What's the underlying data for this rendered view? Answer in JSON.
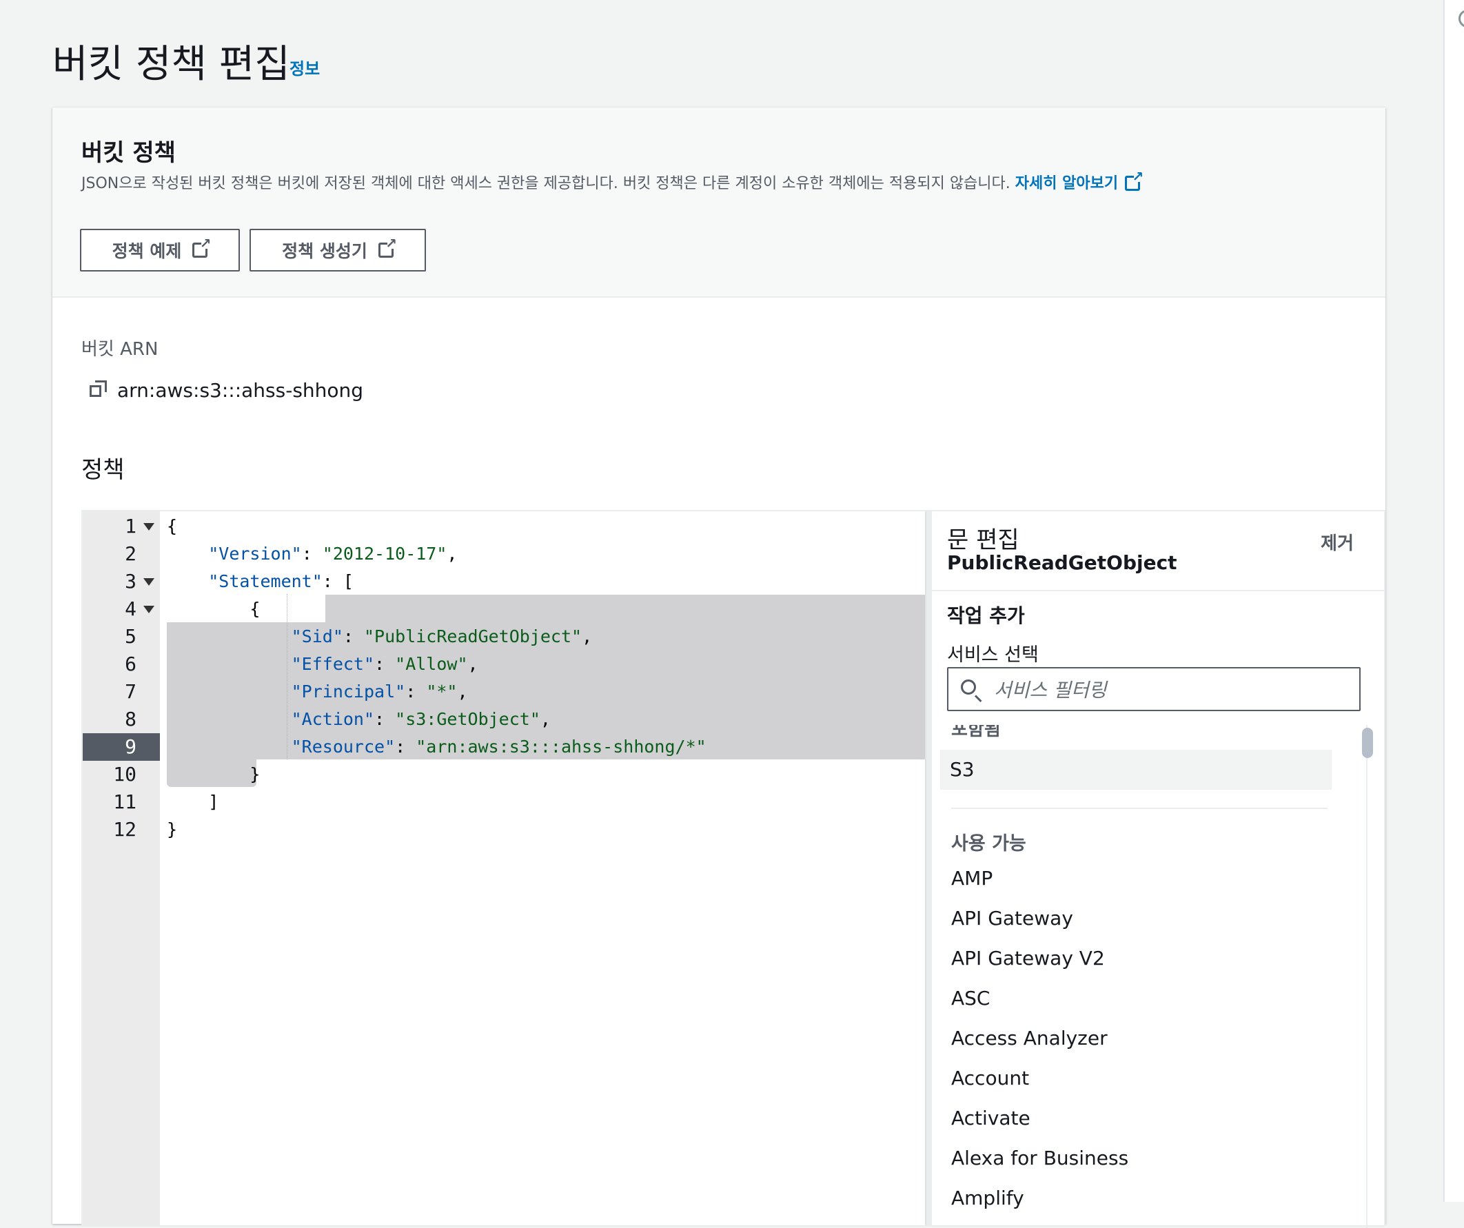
{
  "page": {
    "title": "버킷 정책 편집",
    "info_link": "정보"
  },
  "bucket_policy": {
    "heading": "버킷 정책",
    "description": "JSON으로 작성된 버킷 정책은 버킷에 저장된 객체에 대한 액세스 권한을 제공합니다. 버킷 정책은 다른 계정이 소유한 객체에는 적용되지 않습니다. ",
    "learn_more": "자세히 알아보기",
    "buttons": {
      "examples": "정책 예제",
      "generator": "정책 생성기"
    }
  },
  "arn": {
    "label": "버킷 ARN",
    "value": "arn:aws:s3:::ahss-shhong"
  },
  "policy": {
    "label": "정책",
    "active_line": 9,
    "lines": [
      {
        "n": "1",
        "fold": true
      },
      {
        "n": "2"
      },
      {
        "n": "3",
        "fold": true
      },
      {
        "n": "4",
        "fold": true
      },
      {
        "n": "5"
      },
      {
        "n": "6"
      },
      {
        "n": "7"
      },
      {
        "n": "8"
      },
      {
        "n": "9"
      },
      {
        "n": "10"
      },
      {
        "n": "11"
      },
      {
        "n": "12"
      }
    ],
    "code": {
      "l1": "{",
      "version_key": "\"Version\"",
      "version_val": "\"2012-10-17\"",
      "statement_key": "\"Statement\"",
      "l4": "{",
      "sid_key": "\"Sid\"",
      "sid_val": "\"PublicReadGetObject\"",
      "effect_key": "\"Effect\"",
      "effect_val": "\"Allow\"",
      "principal_key": "\"Principal\"",
      "principal_val": "\"*\"",
      "action_key": "\"Action\"",
      "action_val": "\"s3:GetObject\"",
      "resource_key": "\"Resource\"",
      "resource_val": "\"arn:aws:s3:::ahss-shhong/*\"",
      "l10": "}",
      "l11": "]",
      "l12": "}"
    }
  },
  "statement_editor": {
    "title": "문 편집",
    "sid": "PublicReadGetObject",
    "remove": "제거",
    "add_action": "작업 추가",
    "select_service": "서비스 선택",
    "search_placeholder": "서비스 필터링",
    "included_heading": "포함됨",
    "included": [
      "S3"
    ],
    "available_heading": "사용 가능",
    "available": [
      "AMP",
      "API Gateway",
      "API Gateway V2",
      "ASC",
      "Access Analyzer",
      "Account",
      "Activate",
      "Alexa for Business",
      "Amplify"
    ]
  }
}
